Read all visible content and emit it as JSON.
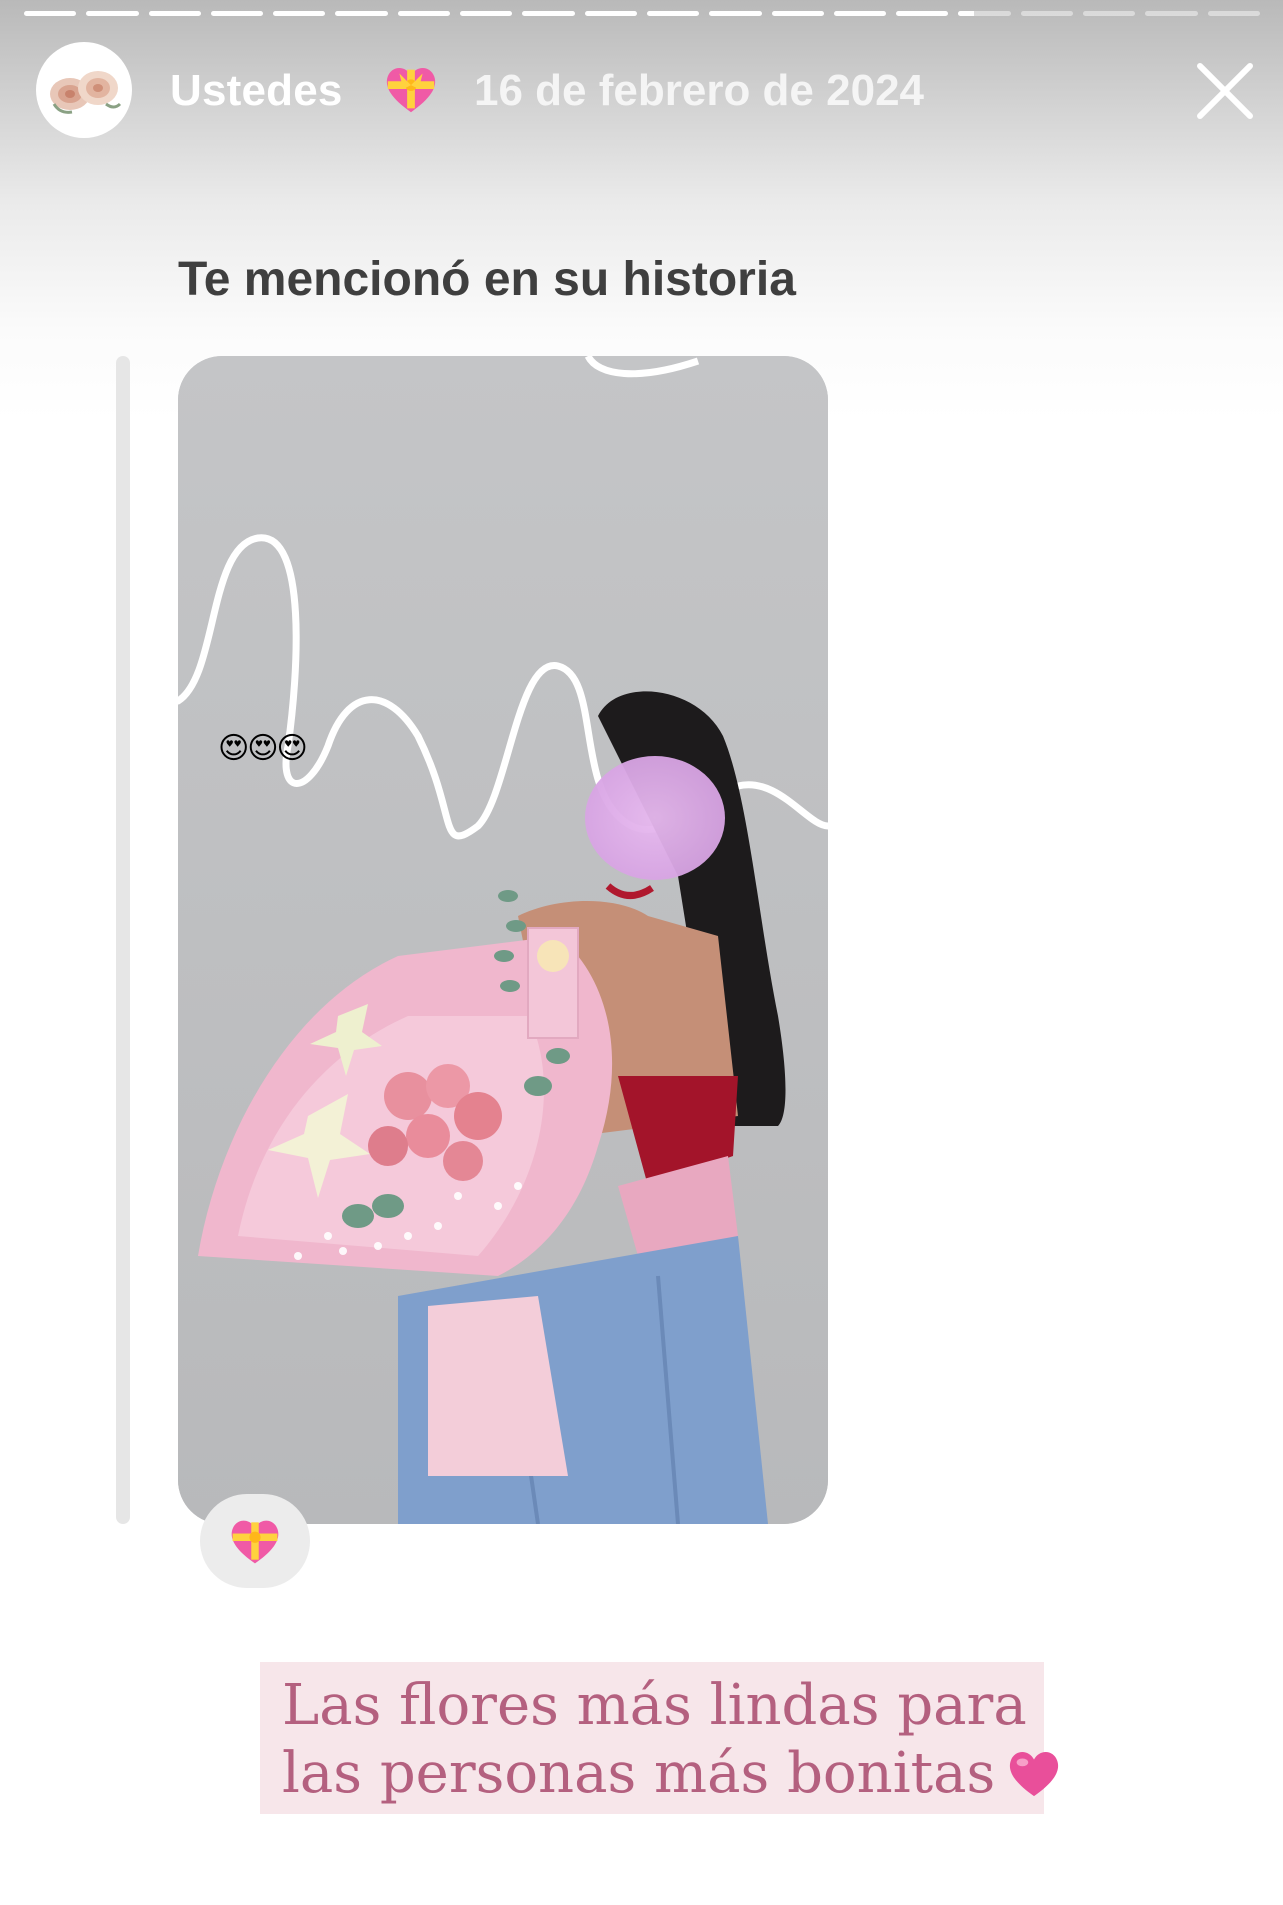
{
  "progress": {
    "segment_count": 20,
    "completed_segments": 15,
    "current_segment_fraction": 0.3
  },
  "header": {
    "username": "Ustedes",
    "username_emoji": "heart-with-ribbon-icon",
    "date": "16 de febrero de 2024",
    "close_icon": "close-icon"
  },
  "mention": {
    "label": "Te mencionó en su historia"
  },
  "story_preview": {
    "overlay_emojis": "😍😍😍",
    "reaction_icon": "heart-with-ribbon-icon"
  },
  "caption": {
    "line1": "Las flores más lindas para",
    "line2": "las personas más bonitas",
    "emoji": "pink-heart-icon"
  },
  "colors": {
    "caption_text": "#b4607f",
    "caption_bg": "#f7e6ea",
    "heart_pink": "#e94f9a"
  }
}
